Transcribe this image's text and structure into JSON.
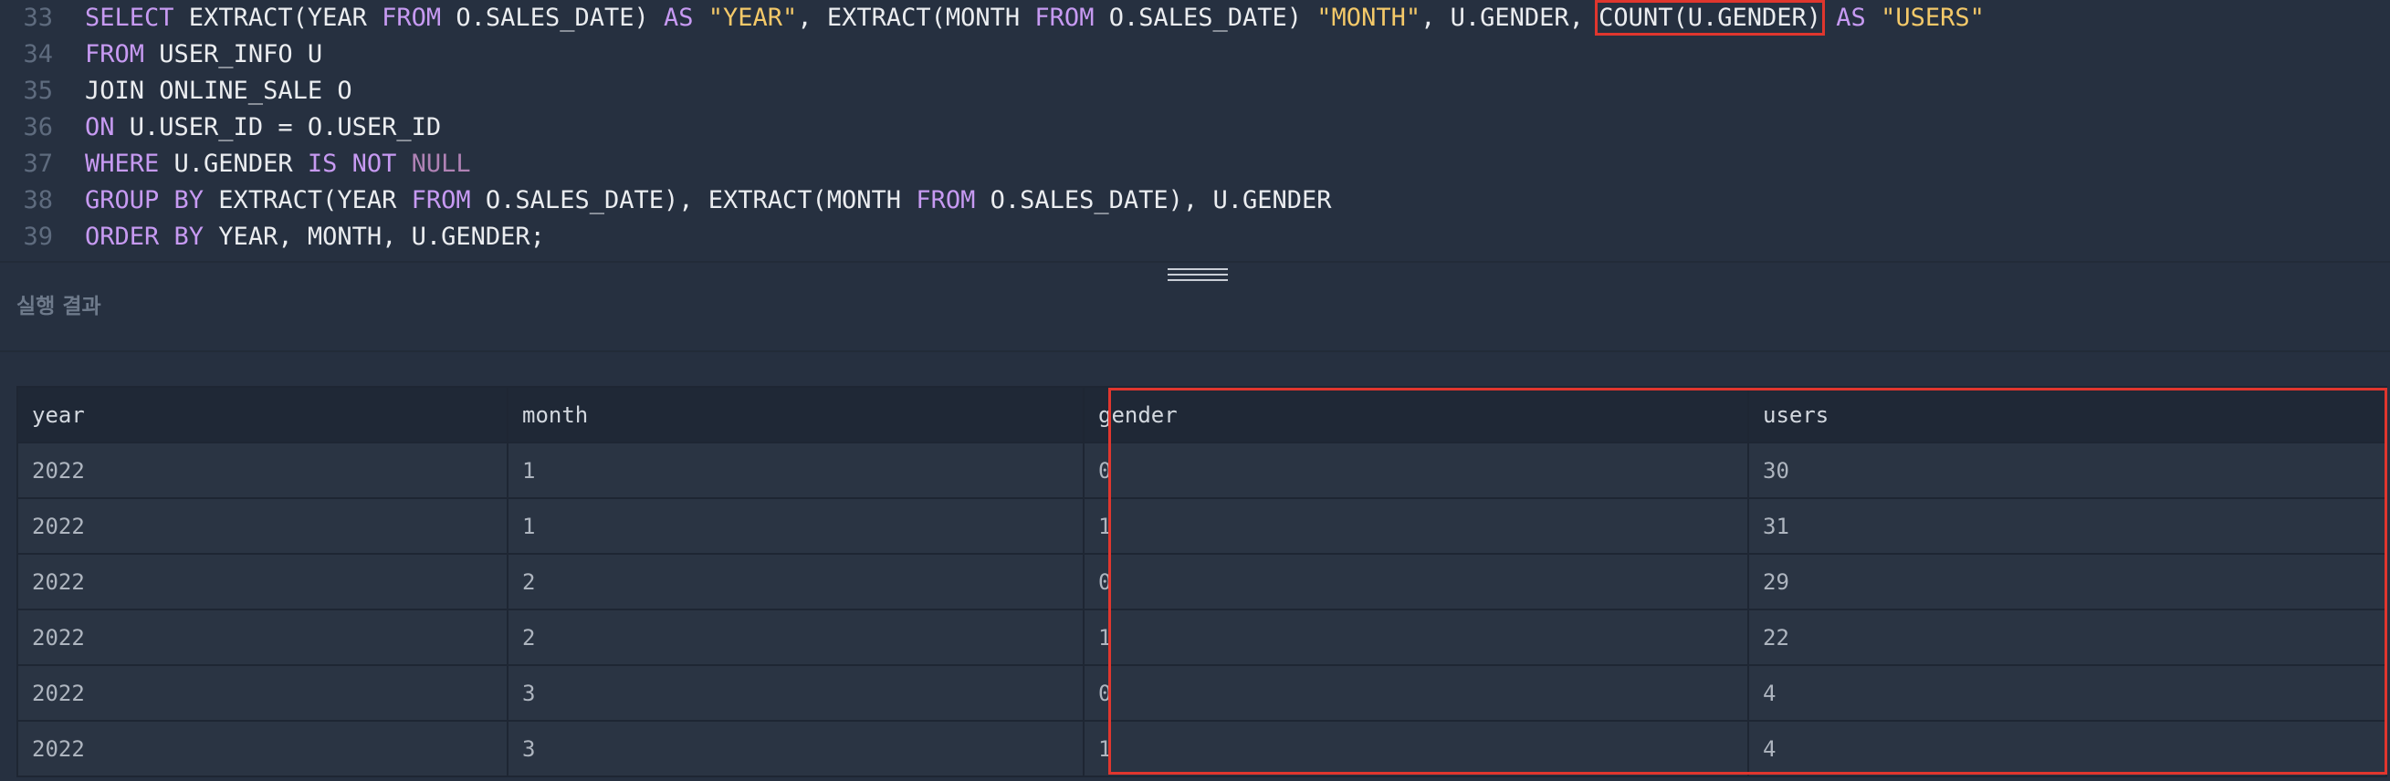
{
  "editor": {
    "lines": [
      {
        "number": "33",
        "tokens": [
          {
            "t": "SELECT",
            "c": "kw"
          },
          {
            "t": " EXTRACT(YEAR ",
            "c": "plain"
          },
          {
            "t": "FROM",
            "c": "kw"
          },
          {
            "t": " O.SALES_DATE) ",
            "c": "plain"
          },
          {
            "t": "AS",
            "c": "kw"
          },
          {
            "t": " ",
            "c": "plain"
          },
          {
            "t": "\"YEAR\"",
            "c": "str"
          },
          {
            "t": ", EXTRACT(MONTH ",
            "c": "plain"
          },
          {
            "t": "FROM",
            "c": "kw"
          },
          {
            "t": " O.SALES_DATE) ",
            "c": "plain"
          },
          {
            "t": "\"MONTH\"",
            "c": "str"
          },
          {
            "t": ", U.GENDER, ",
            "c": "plain"
          },
          {
            "t": "COUNT(U.GENDER)",
            "c": "boxed"
          },
          {
            "t": " ",
            "c": "plain"
          },
          {
            "t": "AS",
            "c": "kw"
          },
          {
            "t": " ",
            "c": "plain"
          },
          {
            "t": "\"USERS\"",
            "c": "str"
          }
        ]
      },
      {
        "number": "34",
        "tokens": [
          {
            "t": "FROM",
            "c": "kw"
          },
          {
            "t": " USER_INFO U",
            "c": "plain"
          }
        ]
      },
      {
        "number": "35",
        "tokens": [
          {
            "t": "JOIN ONLINE_SALE O",
            "c": "plain"
          }
        ]
      },
      {
        "number": "36",
        "tokens": [
          {
            "t": "ON",
            "c": "kw"
          },
          {
            "t": " U.USER_ID = O.USER_ID",
            "c": "plain"
          }
        ]
      },
      {
        "number": "37",
        "tokens": [
          {
            "t": "WHERE",
            "c": "kw"
          },
          {
            "t": " U.GENDER ",
            "c": "plain"
          },
          {
            "t": "IS NOT",
            "c": "kw"
          },
          {
            "t": " ",
            "c": "plain"
          },
          {
            "t": "NULL",
            "c": "null"
          }
        ]
      },
      {
        "number": "38",
        "tokens": [
          {
            "t": "GROUP BY",
            "c": "kw"
          },
          {
            "t": " EXTRACT(YEAR ",
            "c": "plain"
          },
          {
            "t": "FROM",
            "c": "kw"
          },
          {
            "t": " O.SALES_DATE), EXTRACT(MONTH ",
            "c": "plain"
          },
          {
            "t": "FROM",
            "c": "kw"
          },
          {
            "t": " O.SALES_DATE), U.GENDER",
            "c": "plain"
          }
        ]
      },
      {
        "number": "39",
        "tokens": [
          {
            "t": "ORDER BY",
            "c": "kw"
          },
          {
            "t": " YEAR, MONTH, U.GENDER;",
            "c": "plain"
          }
        ]
      }
    ]
  },
  "result": {
    "label": "실행 결과",
    "columns": [
      "year",
      "month",
      "gender",
      "users"
    ],
    "rows": [
      [
        "2022",
        "1",
        "0",
        "30"
      ],
      [
        "2022",
        "1",
        "1",
        "31"
      ],
      [
        "2022",
        "2",
        "0",
        "29"
      ],
      [
        "2022",
        "2",
        "1",
        "22"
      ],
      [
        "2022",
        "3",
        "0",
        "4"
      ],
      [
        "2022",
        "3",
        "1",
        "4"
      ]
    ]
  },
  "colors": {
    "keyword": "#c79af2",
    "string": "#f4c969",
    "highlight": "#e0362e",
    "background": "#263040"
  }
}
